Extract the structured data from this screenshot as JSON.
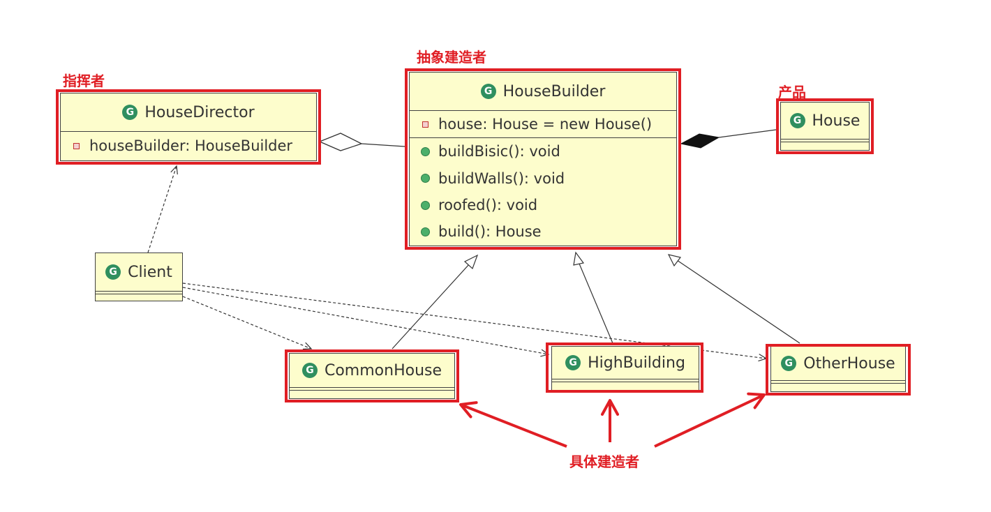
{
  "labels": {
    "director": "指挥者",
    "abstract_builder": "抽象建造者",
    "product": "产品",
    "concrete_builders": "具体建造者"
  },
  "classes": {
    "house_director": {
      "name": "HouseDirector",
      "fields": [
        "houseBuilder: HouseBuilder"
      ]
    },
    "house_builder": {
      "name": "HouseBuilder",
      "fields": [
        "house: House = new House()"
      ],
      "methods": [
        "buildBisic(): void",
        "buildWalls(): void",
        "roofed(): void",
        "build(): House"
      ]
    },
    "house": {
      "name": "House"
    },
    "client": {
      "name": "Client"
    },
    "common_house": {
      "name": "CommonHouse"
    },
    "high_building": {
      "name": "HighBuilding"
    },
    "other_house": {
      "name": "OtherHouse"
    }
  },
  "class_icon_glyph": "G",
  "colors": {
    "annotation_red": "#e01e24",
    "class_fill": "#fdfdcc",
    "class_icon": "#2f8f5f"
  }
}
